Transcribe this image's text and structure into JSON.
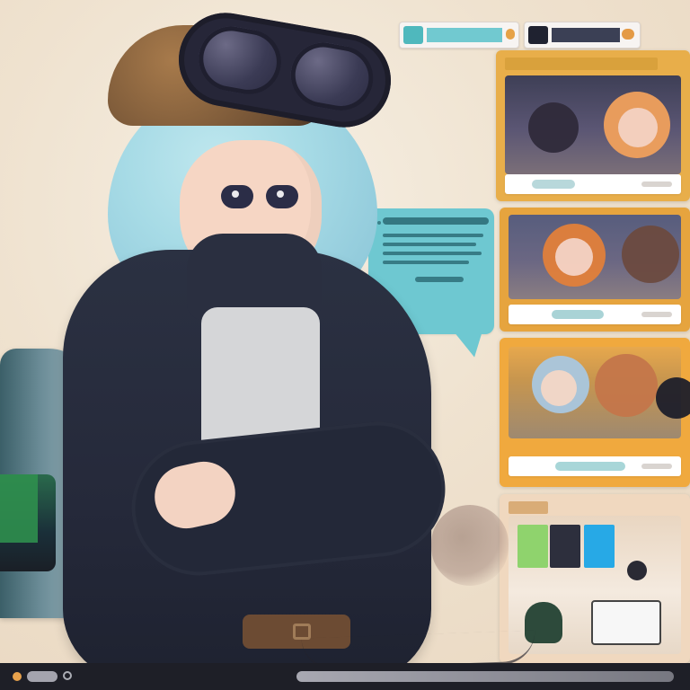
{
  "colors": {
    "background": "#efe2cf",
    "accent_teal": "#6ec8d1",
    "accent_orange": "#f0a93e",
    "bottom_bar": "#1e1f27"
  },
  "icons": {
    "top_pill_left": "app-tab-icon",
    "top_pill_right": "app-tab-icon",
    "bottom_badge": "logo-icon",
    "bottom_ring": "info-icon"
  }
}
